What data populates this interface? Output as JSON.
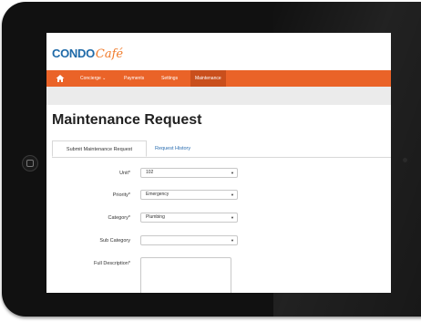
{
  "app": {
    "logo_main": "CONDO",
    "logo_script": "Café"
  },
  "nav": {
    "items": [
      {
        "label": "Concierge ⌄"
      },
      {
        "label": "Payments"
      },
      {
        "label": "Settings"
      },
      {
        "label": "Maintenance"
      }
    ]
  },
  "page": {
    "title": "Maintenance Request"
  },
  "tabs": [
    {
      "label": "Submit Maintenance Request"
    },
    {
      "label": "Request History"
    }
  ],
  "form": {
    "unit": {
      "label": "Unit*",
      "value": "102"
    },
    "priority": {
      "label": "Priority*",
      "value": "Emergency"
    },
    "category": {
      "label": "Category*",
      "value": "Plumbing"
    },
    "sub_category": {
      "label": "Sub Category",
      "value": ""
    },
    "description": {
      "label": "Full Description*"
    }
  },
  "icons": {
    "home": "home-icon",
    "dropdown": "chevron-down-icon"
  },
  "colors": {
    "nav_bg": "#ea6328",
    "nav_active": "#c94f1c",
    "logo_blue": "#1f6aa8",
    "logo_orange": "#f07a2a",
    "link": "#2a6db0"
  }
}
